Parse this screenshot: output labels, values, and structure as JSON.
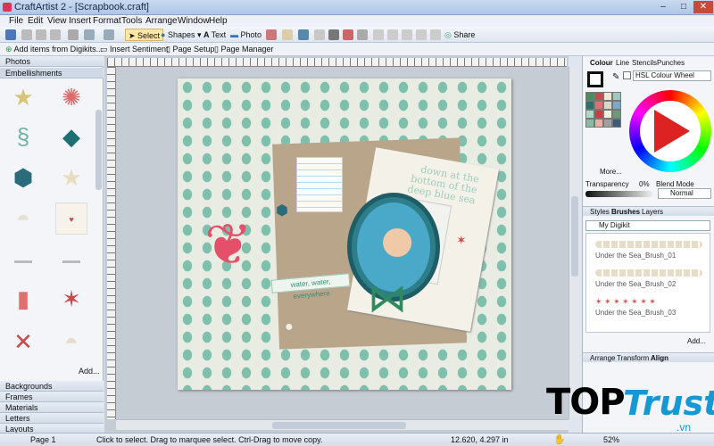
{
  "window": {
    "title": "CraftArtist 2 - [Scrapbook.craft]",
    "minimize": "–",
    "maximize": "□",
    "close": "✕"
  },
  "menu": [
    "File",
    "Edit",
    "View",
    "Insert",
    "Format",
    "Tools",
    "Arrange",
    "Window",
    "Help"
  ],
  "toolbar": {
    "select": "Select",
    "shapes": "Shapes",
    "text": "Text",
    "photo": "Photo",
    "share": "Share"
  },
  "toolbar2": {
    "add_items": "Add items from Digikits...",
    "insert_sentiment": "Insert Sentiment",
    "page_setup": "Page Setup",
    "page_manager": "Page Manager"
  },
  "left": {
    "tab_photos": "Photos",
    "tab_embellishments": "Embellishments",
    "add": "Add...",
    "tab_backgrounds": "Backgrounds",
    "tab_frames": "Frames",
    "tab_materials": "Materials",
    "tab_letters": "Letters",
    "tab_layouts": "Layouts"
  },
  "page": {
    "journal_title": "down at the bottom of the deep blue sea",
    "sentiment": "water, water, everywhere"
  },
  "right": {
    "tabs": [
      "Colour",
      "Line",
      "Stencils",
      "Punches"
    ],
    "colour_mode": "HSL Colour Wheel",
    "more": "More...",
    "transparency_label": "Transparency",
    "transparency_value": "0%",
    "blend_label": "Blend Mode",
    "blend_value": "Normal",
    "tabs2": [
      "Styles",
      "Brushes",
      "Layers"
    ],
    "kit": "My Digikit",
    "brushes": [
      "Under the Sea_Brush_01",
      "Under the Sea_Brush_02",
      "Under the Sea_Brush_03"
    ],
    "add": "Add...",
    "tabs3": [
      "Arrange",
      "Transform",
      "Align"
    ],
    "swatches": [
      "#4a8c5c",
      "#c84b4b",
      "#f5e6d0",
      "#9bc9bc",
      "#2f6f6a",
      "#e07070",
      "#d9d9c8",
      "#7aa8c8",
      "#b0d8c8",
      "#c94040",
      "#f0f0e0",
      "#6a9a7a",
      "#8cb8a8",
      "#e8b0a0",
      "#a0a0a0",
      "#3a5a7a"
    ]
  },
  "status": {
    "page": "Page 1",
    "message": "Click to select. Drag to marquee select. Ctrl-Drag to move copy.",
    "coords": "12.620, 4.297 in",
    "zoom": "52%"
  },
  "logo": {
    "top": "TOP",
    "trust": "Trust",
    "vn": ".vn"
  }
}
